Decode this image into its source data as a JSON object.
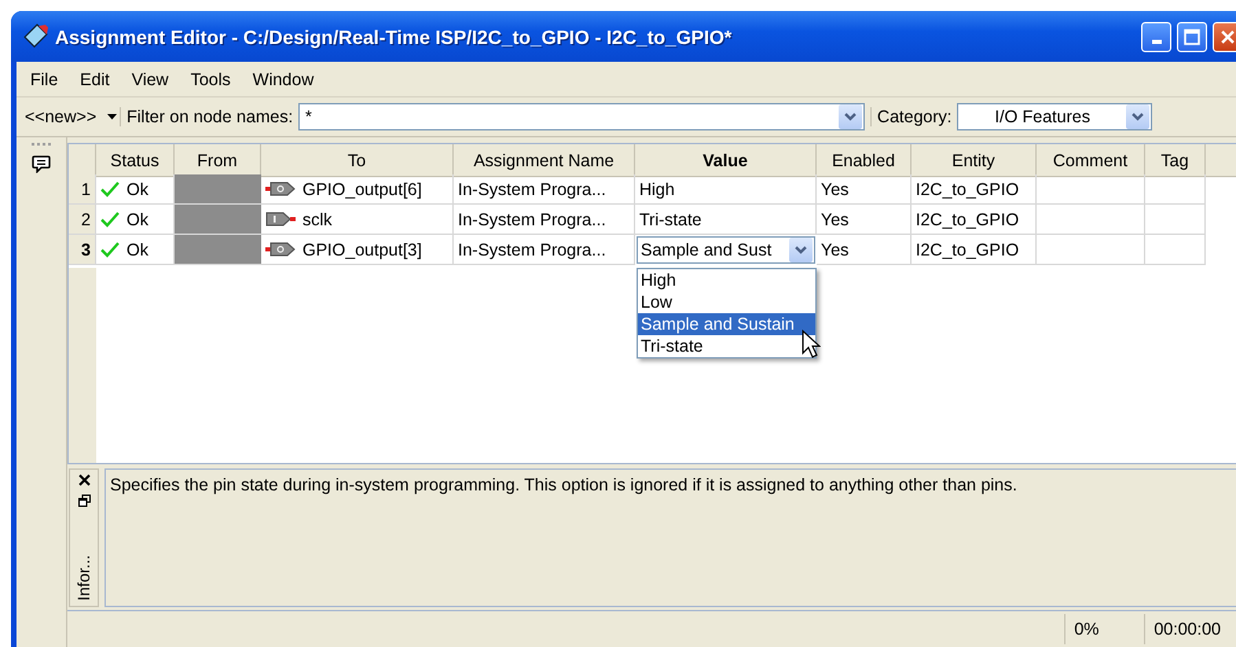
{
  "window": {
    "title": "Assignment Editor - C:/Design/Real-Time ISP/I2C_to_GPIO - I2C_to_GPIO*"
  },
  "menu": [
    "File",
    "Edit",
    "View",
    "Tools",
    "Window"
  ],
  "toolbar": {
    "new_button": "<<new>>",
    "filter_label": "Filter on node names:",
    "filter_value": "*",
    "category_label": "Category:",
    "category_value": "I/O Features"
  },
  "table": {
    "columns": [
      {
        "label": "Status",
        "selected": false
      },
      {
        "label": "From",
        "selected": false
      },
      {
        "label": "To",
        "selected": false
      },
      {
        "label": "Assignment Name",
        "selected": false
      },
      {
        "label": "Value",
        "selected": true
      },
      {
        "label": "Enabled",
        "selected": false
      },
      {
        "label": "Entity",
        "selected": false
      },
      {
        "label": "Comment",
        "selected": false
      },
      {
        "label": "Tag",
        "selected": false
      }
    ],
    "rows": [
      {
        "number": "1",
        "selected": false,
        "status": "Ok",
        "to": {
          "kind": "output",
          "name": "GPIO_output[6]"
        },
        "assignment_name": "In-System Progra...",
        "value": "High",
        "editing": false,
        "enabled": "Yes",
        "entity": "I2C_to_GPIO"
      },
      {
        "number": "2",
        "selected": false,
        "status": "Ok",
        "to": {
          "kind": "input",
          "name": "sclk"
        },
        "assignment_name": "In-System Progra...",
        "value": "Tri-state",
        "editing": false,
        "enabled": "Yes",
        "entity": "I2C_to_GPIO"
      },
      {
        "number": "3",
        "selected": true,
        "status": "Ok",
        "to": {
          "kind": "output",
          "name": "GPIO_output[3]"
        },
        "assignment_name": "In-System Progra...",
        "value": "Sample and Sust",
        "editing": true,
        "enabled": "Yes",
        "entity": "I2C_to_GPIO"
      }
    ],
    "dropdown": {
      "expanded": true,
      "options": [
        {
          "label": "High",
          "selected": false
        },
        {
          "label": "Low",
          "selected": false
        },
        {
          "label": "Sample and Sustain",
          "selected": true
        },
        {
          "label": "Tri-state",
          "selected": false
        }
      ]
    }
  },
  "info_panel": {
    "tab": "Infor...",
    "text": "Specifies the pin state during in-system programming. This option is ignored if it is assigned to anything other than pins."
  },
  "status_bar": {
    "progress": "0%",
    "time": "00:00:00"
  }
}
